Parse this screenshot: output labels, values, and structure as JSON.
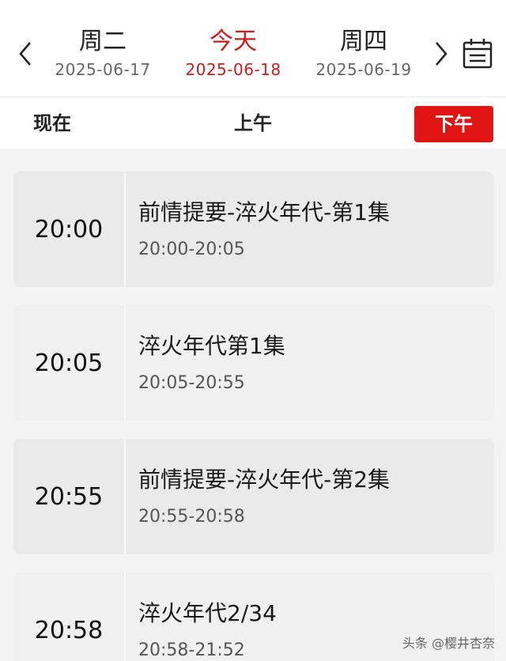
{
  "navigation": {
    "prev_day": {
      "weekday": "周二",
      "date": "2025-06-17"
    },
    "today": {
      "weekday": "今天",
      "date": "2025-06-18"
    },
    "next_day": {
      "weekday": "周四",
      "date": "2025-06-19"
    },
    "prev_icon": "chevron-left-icon",
    "next_icon": "chevron-right-icon",
    "calendar_icon": "calendar-icon",
    "today_color": "#c81e1e"
  },
  "tabs": {
    "now": "现在",
    "morning": "上午",
    "afternoon": "下午",
    "active": "afternoon",
    "active_color": "#e11414"
  },
  "programs": [
    {
      "start": "20:00",
      "title": "前情提要-淬火年代-第1集",
      "range": "20:00-20:05"
    },
    {
      "start": "20:05",
      "title": "淬火年代第1集",
      "range": "20:05-20:55"
    },
    {
      "start": "20:55",
      "title": "前情提要-淬火年代-第2集",
      "range": "20:55-20:58"
    },
    {
      "start": "20:58",
      "title": "淬火年代2/34",
      "range": "20:58-21:52"
    }
  ],
  "watermark": "头条 @樱井杏奈"
}
